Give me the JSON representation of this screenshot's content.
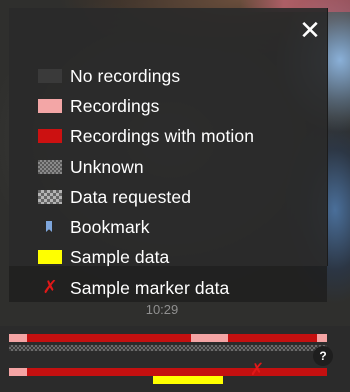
{
  "legend": {
    "close_glyph": "✕",
    "items": [
      {
        "label": "No recordings",
        "swatch": "none",
        "color": "#3a3a3a"
      },
      {
        "label": "Recordings",
        "swatch": "recordings",
        "color": "#f3a6a6"
      },
      {
        "label": "Recordings with motion",
        "swatch": "motion",
        "color": "#cc1111"
      },
      {
        "label": "Unknown",
        "swatch": "unknown-pattern",
        "color": "#8a8a8a"
      },
      {
        "label": "Data requested",
        "swatch": "requested-pattern",
        "color": "#b4b4b4"
      },
      {
        "label": "Bookmark",
        "swatch": "bookmark-icon",
        "color": "#7ea6dc"
      },
      {
        "label": "Sample data",
        "swatch": "sample",
        "color": "#ffff00"
      },
      {
        "label": "Sample marker data",
        "swatch": "marker-icon",
        "color": "#e01818",
        "glyph": "✗"
      }
    ]
  },
  "timeline": {
    "time_label": "10:29",
    "marker_glyph": "✗",
    "help_label": "?"
  }
}
